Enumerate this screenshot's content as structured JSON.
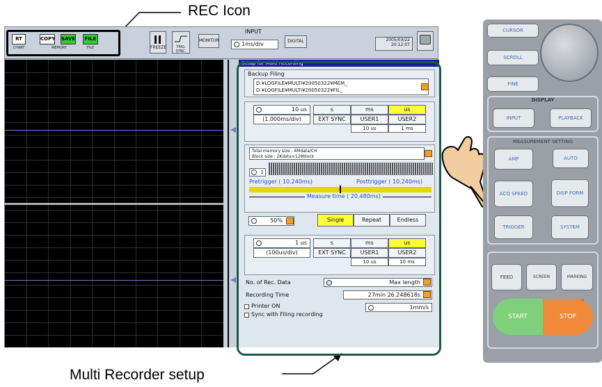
{
  "callouts": {
    "rec_icon": "REC Icon",
    "multi_recorder": "Multi Recorder setup"
  },
  "toolbar": {
    "rec_icons": [
      {
        "label": "RT",
        "sub": "CHART",
        "color": "#ffffff"
      },
      {
        "label": "COPY",
        "sub": "",
        "color": "#ffffff"
      },
      {
        "label": "SAVE",
        "sub": "",
        "color": "#33cc33"
      },
      {
        "label": "FILE",
        "sub": "FILE",
        "color": "#33cc33"
      }
    ],
    "memory_label": "MEMORY",
    "freeze_label": "FREEZE",
    "trig_label": "TRIG. SYNC.",
    "monitor_label": "MONITOR",
    "input_label": "INPUT",
    "input_value": "1ms/div",
    "digital_label": "DIGITAL",
    "date": "2005/03/22",
    "time": "20:12:07"
  },
  "panel": {
    "header": "Setup for Multi Recording",
    "backup": {
      "title": "Backup Filing",
      "path1": "D:¥LOGFILE¥MULTI¥20050322¥MEM_",
      "path2": "D:¥LOGFILE¥MULTI¥20050322¥FIL_"
    },
    "sampling1": {
      "value": "10 us",
      "div": "(1.000ms/div)",
      "units": [
        "s",
        "ms",
        "us"
      ],
      "row2": [
        "EXT SYNC",
        "USER1",
        "USER2"
      ],
      "row3": [
        "10 us",
        "1 ms"
      ]
    },
    "memory": {
      "line1": "Total memory size  :  4Mdata/CH",
      "line2": "Block size         :  2Kdata×128block",
      "block_value": "1",
      "pretrigger": "Pretrigger ( 10.240ms)",
      "posttrigger": "Posttrigger ( 10.240ms)",
      "measure": "Measure time ( 20.480ms)",
      "percent": "50%",
      "modes": [
        "Single",
        "Repeat",
        "Endless"
      ]
    },
    "sampling2": {
      "value": "1 us",
      "div": "(100us/div)",
      "units": [
        "s",
        "ms",
        "us"
      ],
      "row2": [
        "EXT SYNC",
        "USER1",
        "USER2"
      ],
      "row3": [
        "10 us",
        "10 ms"
      ]
    },
    "rec_data_label": "No. of Rec. Data",
    "rec_data_value": "Max length",
    "rec_time_label": "Recording Time",
    "rec_time_value": "27min 26.248618s",
    "printer_label": "Printer ON",
    "printer_value": "1mm/s",
    "sync_label": "Sync with Filing recording"
  },
  "hardware": {
    "cursor": "CURSOR",
    "scroll": "SCROLL",
    "fine": "FINE",
    "display": "DISPLAY",
    "input": "INPUT",
    "playback": "PLAYBACK",
    "measurement": "MEASUREMENT SETTING",
    "amp": "AMP",
    "auto": "AUTO",
    "acq_speed": "ACQ SPEED",
    "disp_form": "DISP FORM",
    "trigger": "TRIGGER",
    "system": "SYSTEM",
    "feed": "FEED",
    "screen_copy": "SCREEN COPY",
    "marking": "MARKING EVENT",
    "start": "START",
    "stop": "STOP"
  },
  "colors": {
    "highlight": "#ffff33",
    "panel_header": "#1a1aa0",
    "start": "#7fd07a",
    "stop": "#f08a3a"
  }
}
